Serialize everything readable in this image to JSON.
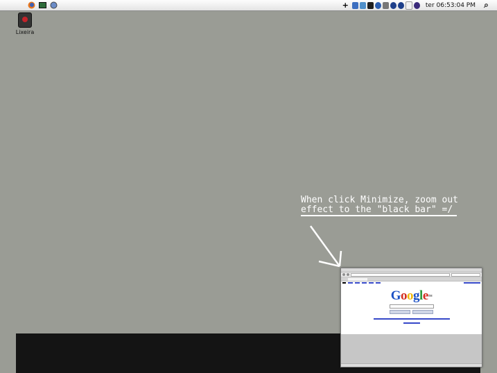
{
  "menubar": {
    "clock": "ter 06:53:04 PM",
    "add_symbol": "+",
    "left_icons": [
      "apple-icon",
      "firefox-icon",
      "terminal-icon",
      "network-icon"
    ],
    "tray_icons": [
      "panel-icon",
      "sync-icon",
      "monitor-icon",
      "bluetooth-icon",
      "volume-icon",
      "info-icon",
      "info-icon",
      "flag-icon",
      "user-icon"
    ],
    "search_glyph": "⌕"
  },
  "desktop": {
    "icons": [
      {
        "label": "Lixeira"
      }
    ]
  },
  "annotation": {
    "line1": "When click Minimize, zoom out",
    "line2": "effect to the \"black bar\" =/"
  },
  "thumbnail": {
    "logo": [
      "G",
      "o",
      "o",
      "g",
      "l",
      "e"
    ],
    "logo_tm": "TM"
  },
  "colors": {
    "desktop_bg": "#9a9c95",
    "black_bar": "#141414",
    "annotation_text": "#ffffff"
  }
}
